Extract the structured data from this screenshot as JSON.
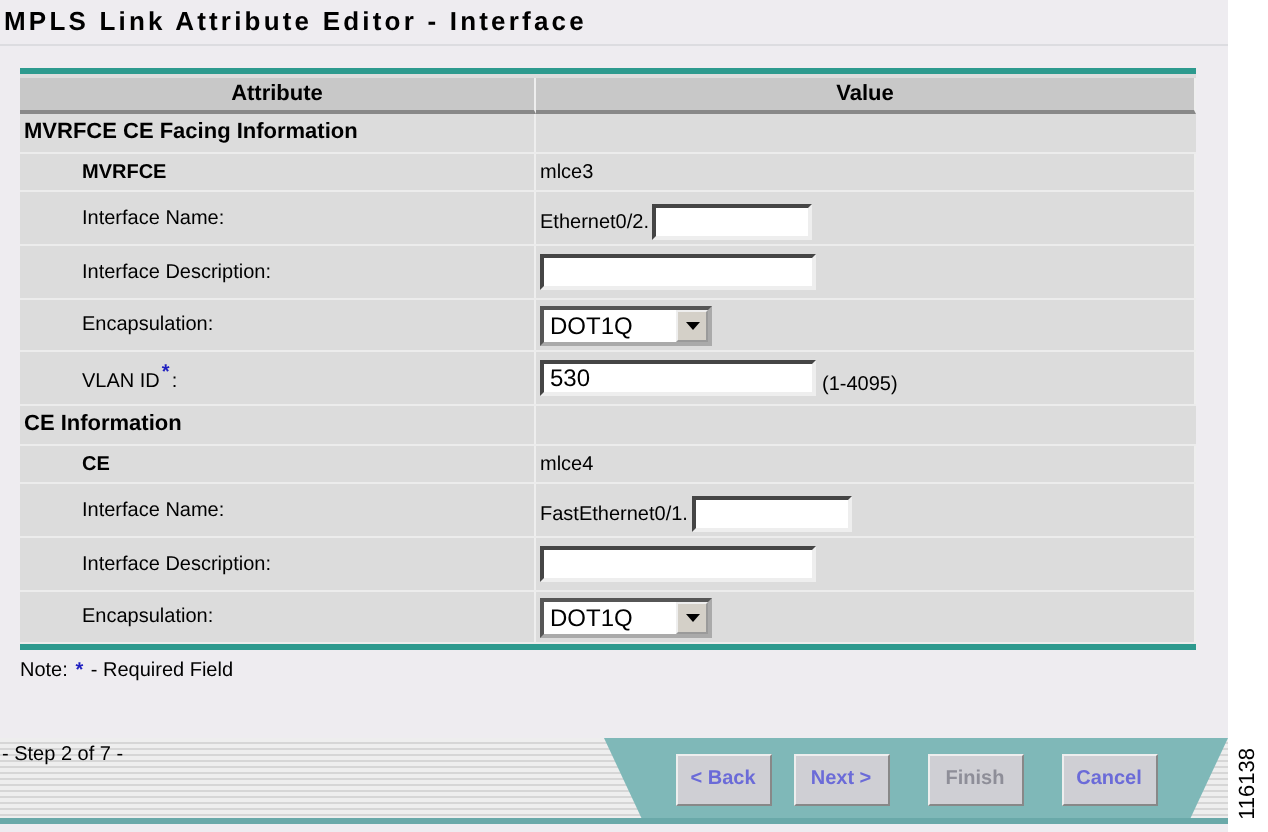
{
  "title": "MPLS Link Attribute Editor - Interface",
  "columns": [
    "Attribute",
    "Value"
  ],
  "sections": [
    {
      "title": "MVRFCE CE Facing Information",
      "rows": [
        {
          "kind": "static",
          "label": "MVRFCE",
          "value": "mlce3"
        },
        {
          "kind": "prefixed",
          "label": "Interface Name:",
          "prefix": "Ethernet0/2."
        },
        {
          "kind": "text",
          "label": "Interface Description:"
        },
        {
          "kind": "select",
          "label": "Encapsulation:",
          "value": "DOT1Q"
        },
        {
          "kind": "text",
          "label": "VLAN ID",
          "required_mark": "*",
          "label_suffix": ":",
          "value": "530",
          "hint": "(1-4095)"
        }
      ]
    },
    {
      "title": "CE Information",
      "rows": [
        {
          "kind": "static",
          "label": "CE",
          "value": "mlce4"
        },
        {
          "kind": "prefixed",
          "label": "Interface Name:",
          "prefix": "FastEthernet0/1."
        },
        {
          "kind": "text",
          "label": "Interface Description:"
        },
        {
          "kind": "select",
          "label": "Encapsulation:",
          "value": "DOT1Q"
        }
      ]
    }
  ],
  "note": {
    "prefix": "Note:",
    "mark": "*",
    "text": "- Required Field"
  },
  "step": "- Step 2 of 7 -",
  "buttons": [
    {
      "label": "< Back",
      "disabled": false
    },
    {
      "label": "Next >",
      "disabled": false
    },
    {
      "label": "Finish",
      "disabled": true
    },
    {
      "label": "Cancel",
      "disabled": false
    }
  ],
  "figure_number": "116138"
}
